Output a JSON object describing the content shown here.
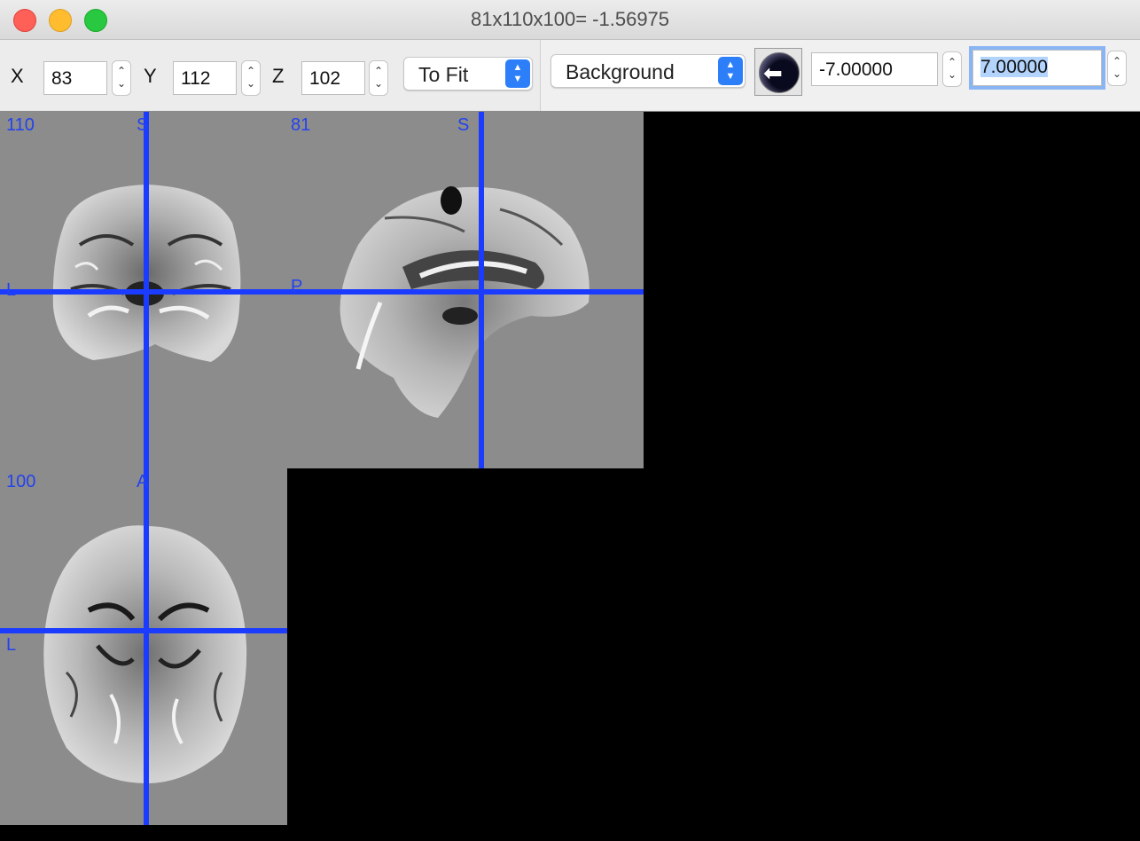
{
  "window": {
    "title": "81x110x100= -1.56975"
  },
  "toolbar": {
    "x_label": "X",
    "x_value": "83",
    "y_label": "Y",
    "y_value": "112",
    "z_label": "Z",
    "z_value": "102",
    "zoom_mode": "To Fit",
    "layer": "Background",
    "min_value": "-7.00000",
    "max_value": "7.00000"
  },
  "views": {
    "coronal": {
      "slice": "110",
      "top": "S",
      "left": "L"
    },
    "sagittal": {
      "slice": "81",
      "top": "S",
      "left": "P"
    },
    "axial": {
      "slice": "100",
      "top": "A",
      "left": "L"
    }
  },
  "colors": {
    "crosshair": "#1b3cff",
    "label": "#2342ee",
    "view_background": "#8c8c8c",
    "accent": "#2d7ff9"
  },
  "icons": {
    "swap": "swap-arrow-icon"
  }
}
